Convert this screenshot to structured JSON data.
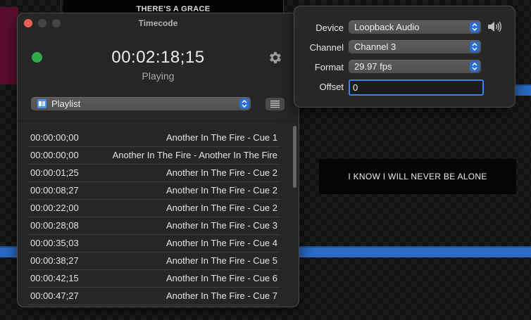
{
  "background": {
    "top_slide_text": "THERE'S A GRACE",
    "right_slide_text": "I KNOW I WILL NEVER BE ALONE"
  },
  "window": {
    "title": "Timecode",
    "timecode": "00:02:18;15",
    "state": "Playing",
    "status_color": "#2fa94a",
    "status_icon": "status-dot-icon",
    "settings_icon": "gear-icon",
    "playlist_select": {
      "value": "Playlist",
      "icon": "playlist-icon"
    },
    "list_button_icon": "list-icon",
    "cues": [
      {
        "time": "00:00:00;00",
        "name": "Another In The Fire - Cue 1"
      },
      {
        "time": "00:00:00;00",
        "name": "Another In The Fire - Another In The Fire"
      },
      {
        "time": "00:00:01;25",
        "name": "Another In The Fire - Cue 2"
      },
      {
        "time": "00:00:08;27",
        "name": "Another In The Fire - Cue 2"
      },
      {
        "time": "00:00:22;00",
        "name": "Another In The Fire - Cue 2"
      },
      {
        "time": "00:00:28;08",
        "name": "Another In The Fire - Cue 3"
      },
      {
        "time": "00:00:35;03",
        "name": "Another In The Fire - Cue 4"
      },
      {
        "time": "00:00:38;27",
        "name": "Another In The Fire - Cue 5"
      },
      {
        "time": "00:00:42;15",
        "name": "Another In The Fire - Cue 6"
      },
      {
        "time": "00:00:47;27",
        "name": "Another In The Fire - Cue 7"
      }
    ]
  },
  "popover": {
    "device_label": "Device",
    "device_value": "Loopback Audio",
    "channel_label": "Channel",
    "channel_value": "Channel 3",
    "format_label": "Format",
    "format_value": "29.97 fps",
    "offset_label": "Offset",
    "offset_value": "0",
    "speaker_icon": "speaker-icon",
    "accent_color": "#2d6ed6"
  }
}
